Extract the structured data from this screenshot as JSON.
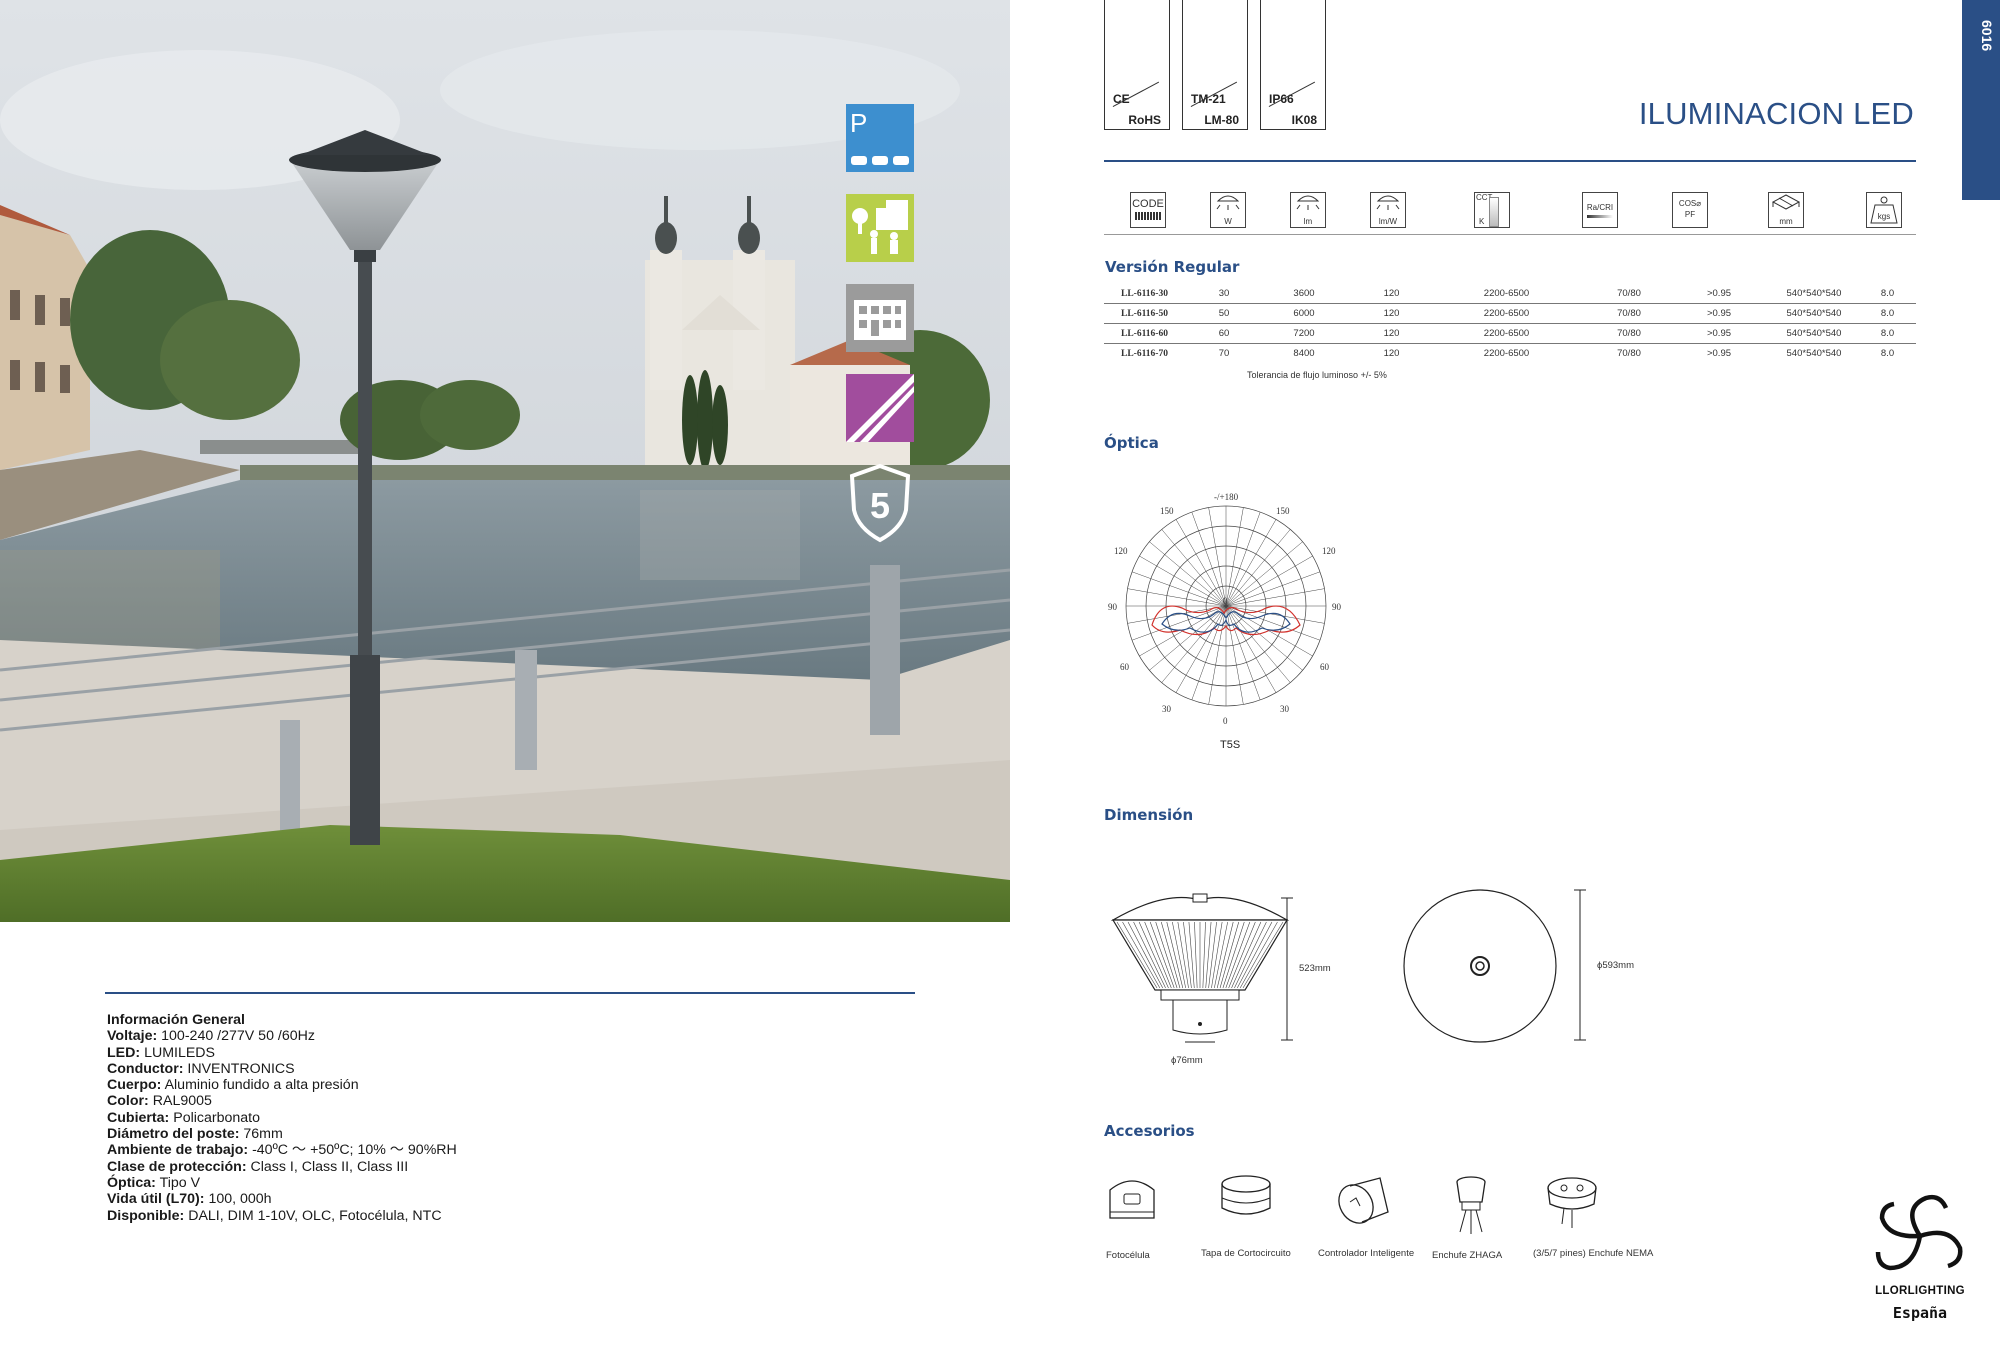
{
  "certifications": [
    {
      "top": "CE",
      "bottom": "RoHS"
    },
    {
      "top": "TM-21",
      "bottom": "LM-80"
    },
    {
      "top": "IP66",
      "bottom": "IK08"
    }
  ],
  "title": "ILUMINACION LED",
  "page_number": "6016",
  "app_icons": [
    {
      "name": "parking-icon",
      "letter": "P",
      "color": "#3d8fcf"
    },
    {
      "name": "pedestrian-street-icon",
      "color": "#b8cf4a"
    },
    {
      "name": "building-icon",
      "color": "#9b9b9b"
    },
    {
      "name": "road-icon",
      "color": "#a14d9d"
    },
    {
      "name": "warranty-shield-icon",
      "label": "5"
    }
  ],
  "spec_header": {
    "code": "CODE",
    "power": "W",
    "lumen": "lm",
    "efficacy": "lm/W",
    "cct_top": "CCT",
    "cct_bottom": "K",
    "cri": "Ra/CRI",
    "pf_top": "COS⌀",
    "pf_bottom": "PF",
    "size": "mm",
    "weight": "kgs"
  },
  "version_title": "Versión Regular",
  "spec_rows": [
    {
      "code": "LL-6116-30",
      "w": "30",
      "lm": "3600",
      "lmw": "120",
      "cct": "2200-6500",
      "cri": "70/80",
      "pf": ">0.95",
      "mm": "540*540*540",
      "kg": "8.0"
    },
    {
      "code": "LL-6116-50",
      "w": "50",
      "lm": "6000",
      "lmw": "120",
      "cct": "2200-6500",
      "cri": "70/80",
      "pf": ">0.95",
      "mm": "540*540*540",
      "kg": "8.0"
    },
    {
      "code": "LL-6116-60",
      "w": "60",
      "lm": "7200",
      "lmw": "120",
      "cct": "2200-6500",
      "cri": "70/80",
      "pf": ">0.95",
      "mm": "540*540*540",
      "kg": "8.0"
    },
    {
      "code": "LL-6116-70",
      "w": "70",
      "lm": "8400",
      "lmw": "120",
      "cct": "2200-6500",
      "cri": "70/80",
      "pf": ">0.95",
      "mm": "540*540*540",
      "kg": "8.0"
    }
  ],
  "tolerance": "Tolerancia de flujo luminoso +/- 5%",
  "optics_title": "Óptica",
  "polar_labels": {
    "top": "-/+180",
    "l150": "150",
    "r150": "150",
    "l120": "120",
    "r120": "120",
    "l90": "90",
    "r90": "90",
    "l60": "60",
    "r60": "60",
    "l30": "30",
    "r30": "30",
    "bottom": "0",
    "center": "0"
  },
  "optics_type": "T5S",
  "dimension_title": "Dimensión",
  "dimensions": {
    "height": "523mm",
    "diameter": "ϕ593mm",
    "pole": "ϕ76mm"
  },
  "accessories_title": "Accesorios",
  "accessories": [
    {
      "name": "photocell",
      "label": "Fotocélula"
    },
    {
      "name": "shorting-cap",
      "label": "Tapa de Cortocircuito"
    },
    {
      "name": "smart-controller",
      "label": "Controlador Inteligente"
    },
    {
      "name": "zhaga-socket",
      "label": "Enchufe ZHAGA"
    },
    {
      "name": "nema-socket",
      "label": "(3/5/7 pines) Enchufe NEMA"
    }
  ],
  "general_info": {
    "heading": "Información General",
    "items": [
      {
        "key": "Voltaje:",
        "value": "100-240 /277V 50 /60Hz"
      },
      {
        "key": "LED:",
        "value": "LUMILEDS"
      },
      {
        "key": "Conductor:",
        "value": "INVENTRONICS"
      },
      {
        "key": "Cuerpo:",
        "value": "Aluminio fundido a alta presión"
      },
      {
        "key": "Color:",
        "value": "RAL9005"
      },
      {
        "key": "Cubierta:",
        "value": "Policarbonato"
      },
      {
        "key": "Diámetro del poste:",
        "value": "76mm"
      },
      {
        "key": "Ambiente de trabajo:",
        "value": "-40ºC ～ +50ºC; 10% ～ 90%RH"
      },
      {
        "key": "Clase de protección:",
        "value": "Class I, Class II, Class III"
      },
      {
        "key": "Óptica:",
        "value": "Tipo V"
      },
      {
        "key": "Vida útil (L70):",
        "value": "100, 000h"
      },
      {
        "key": "Disponible:",
        "value": "DALI, DIM 1-10V, OLC, Fotocélula, NTC"
      }
    ]
  },
  "logo": {
    "name": "LLORLIGHTING",
    "country": "España"
  },
  "colors": {
    "brand": "#2a4f86"
  }
}
